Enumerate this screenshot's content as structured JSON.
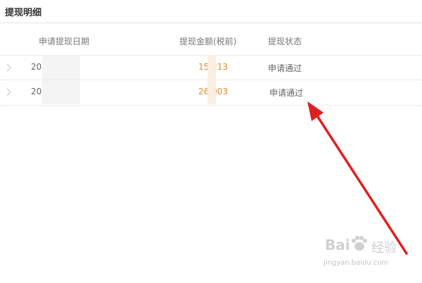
{
  "header": {
    "title": "提现明细"
  },
  "table": {
    "columns": [
      "申请提现日期",
      "提现金额(税前)",
      "提现状态"
    ],
    "rows": [
      {
        "date": "20",
        "amount": "15  213",
        "status": "申请通过"
      },
      {
        "date": "20",
        "amount": "26  003",
        "status": "申请通过"
      }
    ]
  },
  "annotation": {
    "arrow_color": "#e02020"
  },
  "watermark": {
    "brand": "Bai",
    "product": "经验",
    "url": "jingyan.baidu.com"
  },
  "colors": {
    "amount": "#e08a2a",
    "header_text": "#333333",
    "body_text": "#666666"
  }
}
